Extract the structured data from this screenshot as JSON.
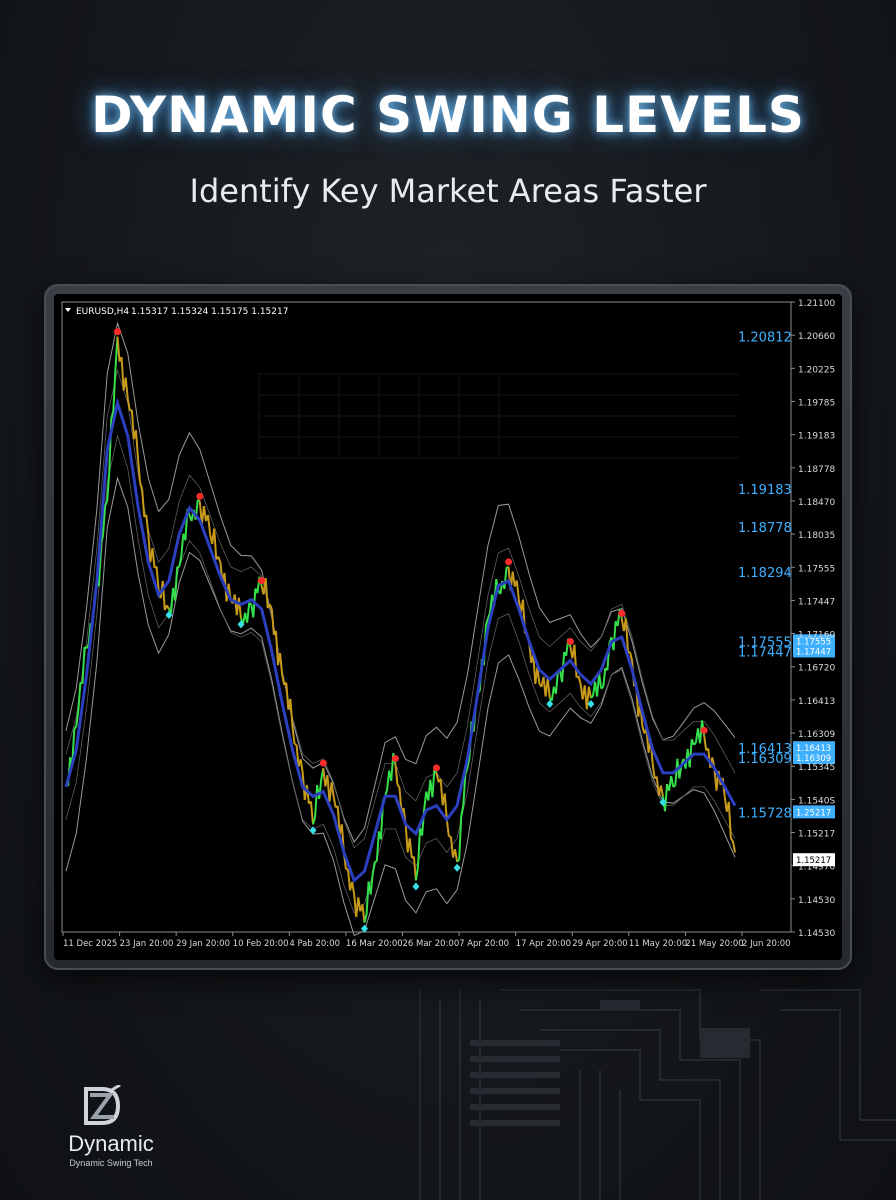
{
  "header": {
    "title": "DYNAMIC SWING LEVELS",
    "subtitle": "Identify Key Market Areas Faster"
  },
  "brand": {
    "name": "Dynamic",
    "tagline": "Dynamic Swing Tech",
    "logo_icon": "dz-monogram-icon"
  },
  "colors": {
    "level_line": "#3fb0ff",
    "level_glow": "#1e90ff",
    "price_up": "#35e04a",
    "price_down": "#c79a1a",
    "swing_high_marker": "#ff2a2a",
    "swing_low_marker": "#35e0e8",
    "moving_average": "#2b3fbf",
    "envelope": "#9a9a9a",
    "price_tag_bg": "#3fb0ff"
  },
  "chart_data": {
    "type": "line",
    "symbol_label": "EURUSD,H4",
    "ohlc_label": "1.15317 1.15324 1.15175 1.15217",
    "x_ticks": [
      "11 Dec 2025",
      "23 Jan 20:00",
      "29 Jan 20:00",
      "10 Feb 20:00",
      "4 Pab 20:00",
      "16 Mar 20:00",
      "26 Mar 20:00",
      "7 Apr 20:00",
      "17 Apr 20:00",
      "29 Apr 20:00",
      "11 May 20:00",
      "21 May 20:00",
      "2 Jun 20:00"
    ],
    "y_ticks": [
      "1.21100",
      "1.20660",
      "1.20225",
      "1.19785",
      "1.19183",
      "1.18778",
      "1.18470",
      "1.18035",
      "1.17555",
      "1.17447",
      "1.17160",
      "1.16720",
      "1.16413",
      "1.16309",
      "1.15345",
      "1.1540S",
      "1.15217",
      "1.14970",
      "1.14530",
      "1.14530"
    ],
    "ylim": [
      1.1445,
      1.2118
    ],
    "grid": false,
    "swing_levels": [
      {
        "label": "1.20812",
        "value": 1.20812,
        "axis_tag": ""
      },
      {
        "label": "1.19183",
        "value": 1.19183,
        "axis_tag": ""
      },
      {
        "label": "1.18778",
        "value": 1.18778,
        "axis_tag": ""
      },
      {
        "label": "1.18294",
        "value": 1.18294,
        "axis_tag": ""
      },
      {
        "label": "1.17555",
        "value": 1.17555,
        "axis_tag": "1.17555"
      },
      {
        "label": "1.17447",
        "value": 1.17447,
        "axis_tag": "1.17447"
      },
      {
        "label": "1.16413",
        "value": 1.16413,
        "axis_tag": "1.16413"
      },
      {
        "label": "1.16309",
        "value": 1.16309,
        "axis_tag": "1.16309"
      },
      {
        "label": "1.15728",
        "value": 1.15728,
        "axis_tag": "1.25217"
      }
    ],
    "current_price_tag": "1.15217",
    "series": [
      {
        "values": [
          1.1602,
          1.1665,
          1.1748,
          1.1815,
          1.1905,
          1.2081,
          1.2015,
          1.195,
          1.187,
          1.181,
          1.179,
          1.1835,
          1.189,
          1.1905,
          1.187,
          1.184,
          1.18,
          1.178,
          1.1795,
          1.1815,
          1.179,
          1.172,
          1.1665,
          1.1615,
          1.156,
          1.162,
          1.159,
          1.153,
          1.1485,
          1.1455,
          1.152,
          1.159,
          1.1625,
          1.156,
          1.15,
          1.1595,
          1.1615,
          1.1565,
          1.152,
          1.162,
          1.17,
          1.178,
          1.181,
          1.1835,
          1.18,
          1.1755,
          1.171,
          1.1695,
          1.1725,
          1.175,
          1.171,
          1.1695,
          1.1705,
          1.176,
          1.178,
          1.1735,
          1.1665,
          1.1625,
          1.159,
          1.16,
          1.163,
          1.1645,
          1.1655,
          1.162,
          1.159,
          1.153
        ]
      },
      {
        "values": [
          1.16,
          1.164,
          1.172,
          1.182,
          1.196,
          1.201,
          1.1975,
          1.19,
          1.184,
          1.1805,
          1.182,
          1.187,
          1.1898,
          1.1885,
          1.1855,
          1.1825,
          1.18,
          1.1795,
          1.18,
          1.179,
          1.1745,
          1.169,
          1.164,
          1.16,
          1.159,
          1.1595,
          1.157,
          1.153,
          1.15,
          1.151,
          1.155,
          1.159,
          1.159,
          1.156,
          1.155,
          1.1575,
          1.158,
          1.1565,
          1.158,
          1.163,
          1.17,
          1.177,
          1.1815,
          1.182,
          1.179,
          1.1755,
          1.1725,
          1.1715,
          1.1725,
          1.1735,
          1.172,
          1.171,
          1.1725,
          1.1755,
          1.176,
          1.1725,
          1.168,
          1.164,
          1.1615,
          1.1615,
          1.1625,
          1.1635,
          1.1635,
          1.162,
          1.16,
          1.158
        ]
      }
    ]
  }
}
